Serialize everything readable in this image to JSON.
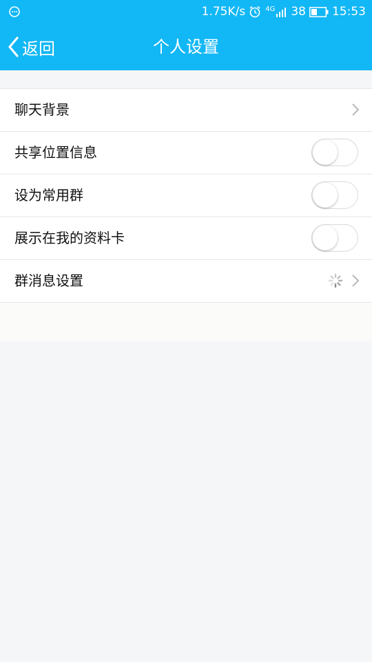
{
  "status_bar": {
    "net_speed": "1.75K/s",
    "network_type": "4G",
    "battery_level": "38",
    "time": "15:53",
    "icons": [
      "chat-bubble-icon",
      "alarm-clock-icon",
      "signal-icon",
      "battery-icon"
    ]
  },
  "header": {
    "back_label": "返回",
    "title": "个人设置",
    "background_color": "#12b7f5"
  },
  "settings": {
    "items": [
      {
        "label": "聊天背景",
        "control": "chevron"
      },
      {
        "label": "共享位置信息",
        "control": "toggle",
        "on": false
      },
      {
        "label": "设为常用群",
        "control": "toggle",
        "on": false
      },
      {
        "label": "展示在我的资料卡",
        "control": "toggle",
        "on": false
      },
      {
        "label": "群消息设置",
        "control": "loading-chevron"
      }
    ]
  }
}
